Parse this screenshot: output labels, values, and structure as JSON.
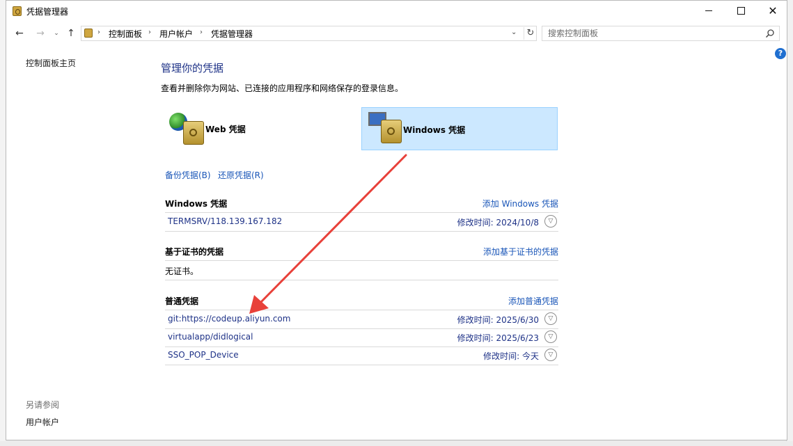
{
  "window": {
    "title": "凭据管理器",
    "controls": {
      "minimize": "—",
      "maximize": "☐",
      "close": "✕"
    }
  },
  "nav": {
    "back": "←",
    "forward": "→",
    "recent": "⌄",
    "up": "↑",
    "breadcrumb": [
      "控制面板",
      "用户帐户",
      "凭据管理器"
    ],
    "address_dropdown": "⌄",
    "refresh": "↻",
    "search_placeholder": "搜索控制面板"
  },
  "help": "?",
  "left_pane": {
    "home_link": "控制面板主页",
    "see_also_label": "另请参阅",
    "see_also_items": [
      "用户帐户"
    ]
  },
  "main": {
    "title": "管理你的凭据",
    "description": "查看并删除你为网站、已连接的应用程序和网络保存的登录信息。",
    "categories": [
      {
        "label": "Web 凭据",
        "icon": "web-credentials-icon",
        "selected": false
      },
      {
        "label": "Windows 凭据",
        "icon": "windows-credentials-icon",
        "selected": true
      }
    ],
    "backup_link": "备份凭据(B)",
    "restore_link": "还原凭据(R)",
    "sections": {
      "windows": {
        "heading": "Windows 凭据",
        "add_link": "添加 Windows 凭据",
        "items": [
          {
            "name": "TERMSRV/118.139.167.182",
            "modified": "修改时间:  2024/10/8"
          }
        ]
      },
      "certificate": {
        "heading": "基于证书的凭据",
        "add_link": "添加基于证书的凭据",
        "empty_text": "无证书。"
      },
      "generic": {
        "heading": "普通凭据",
        "add_link": "添加普通凭据",
        "items": [
          {
            "name": "git:https://codeup.aliyun.com",
            "modified": "修改时间:  2025/6/30"
          },
          {
            "name": "virtualapp/didlogical",
            "modified": "修改时间:  2025/6/23"
          },
          {
            "name": "SSO_POP_Device",
            "modified": "修改时间:  今天"
          }
        ]
      }
    }
  },
  "colors": {
    "selected_tile_bg": "#cce8ff",
    "link": "#1a56b8",
    "heading": "#1e3287",
    "annotation_arrow": "#e8413a"
  }
}
